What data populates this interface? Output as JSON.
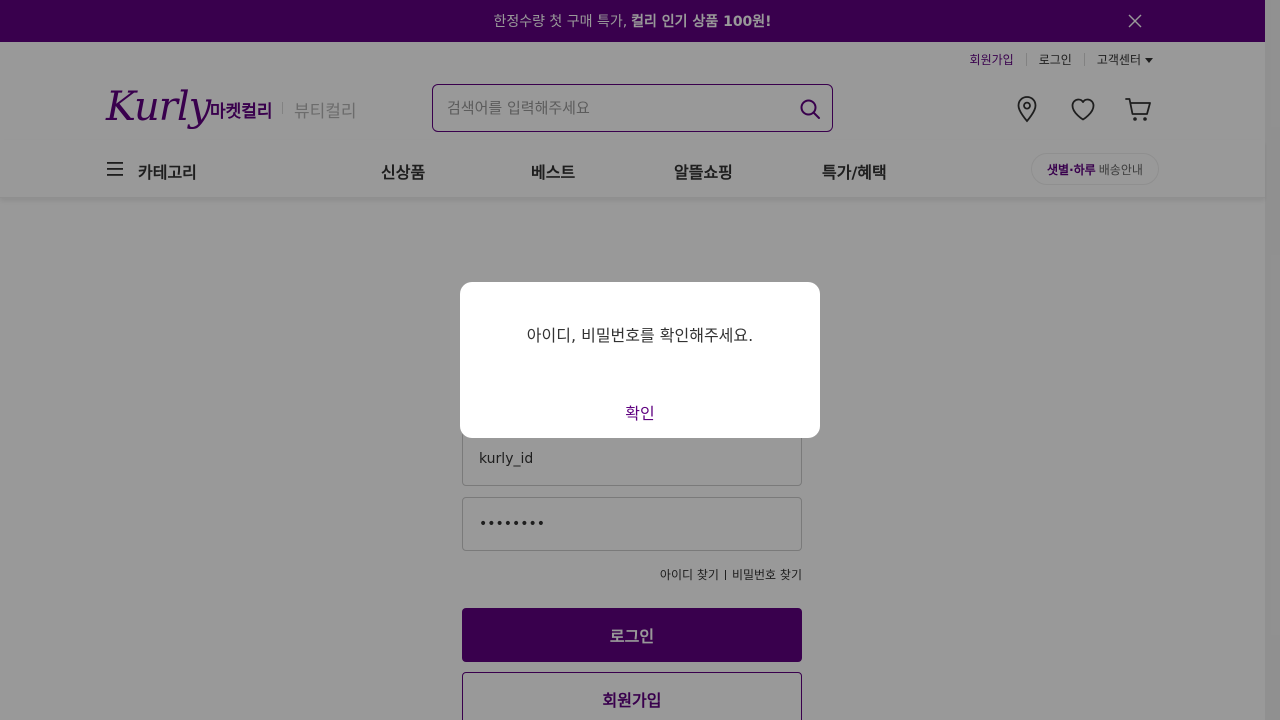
{
  "promo_banner": {
    "text": "한정수량 첫 구매 특가,",
    "highlight": "컬리 인기 상품 100원!",
    "close_icon": "close-icon"
  },
  "user_menu": {
    "signup": "회원가입",
    "login": "로그인",
    "customer_center": "고객센터"
  },
  "header": {
    "logo": "Kurly",
    "market_tab": "마켓컬리",
    "beauty_tab": "뷰티컬리",
    "search_placeholder": "검색어를 입력해주세요",
    "icons": [
      "location-icon",
      "heart-icon",
      "cart-icon"
    ]
  },
  "nav": {
    "category": "카테고리",
    "links": [
      "신상품",
      "베스트",
      "알뜰쇼핑",
      "특가/혜택"
    ],
    "delivery_highlight": "샛별·하루",
    "delivery_text": "배송안내"
  },
  "login_form": {
    "id_value": "kurly_id",
    "password_value": "••••••••",
    "find_id": "아이디 찾기",
    "find_password": "비밀번호 찾기",
    "login_button": "로그인",
    "signup_button": "회원가입"
  },
  "modal": {
    "message": "아이디, 비밀번호를 확인해주세요.",
    "confirm": "확인"
  },
  "colors": {
    "brand": "#5f0080",
    "overlay": "rgba(0,0,0,0.4)"
  }
}
